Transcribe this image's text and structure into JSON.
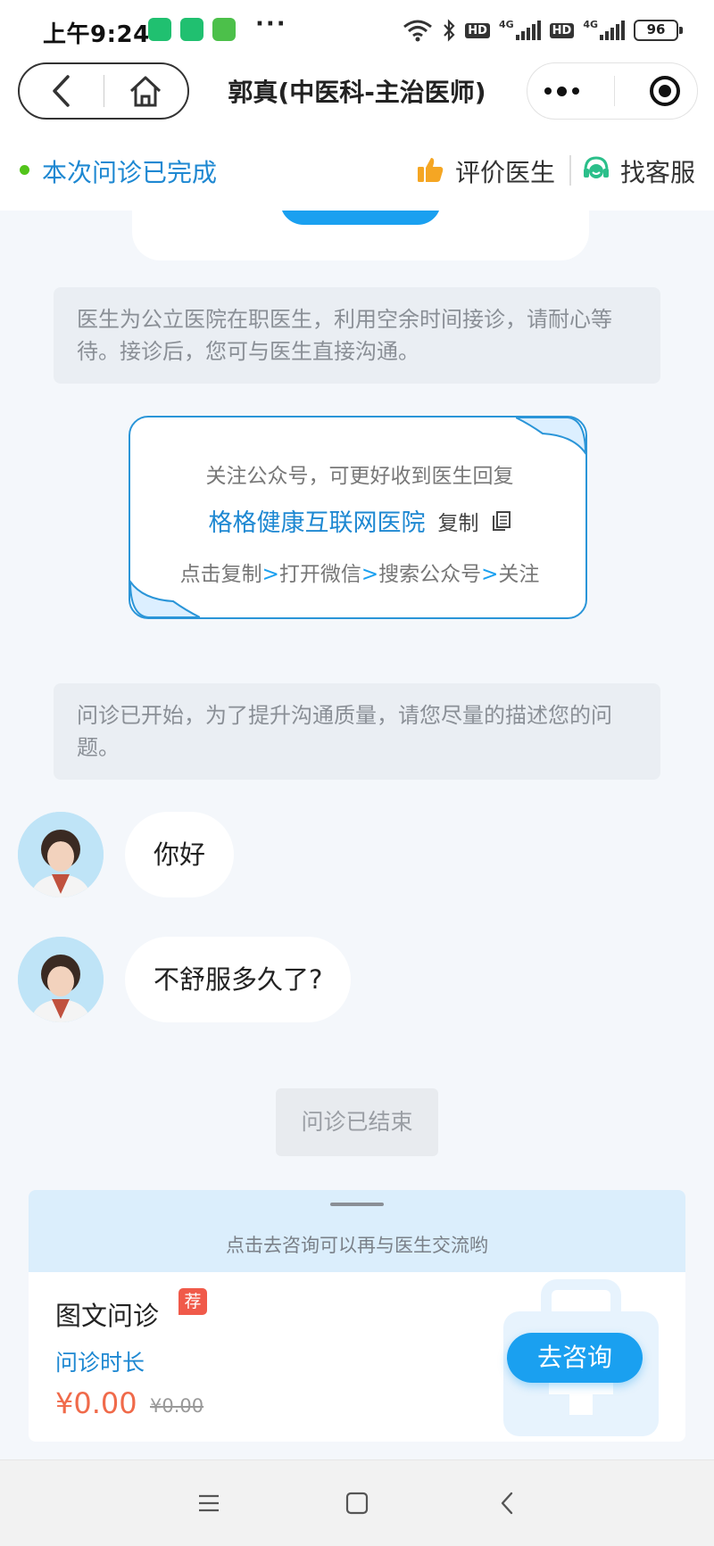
{
  "status_bar": {
    "time": "上午9:24",
    "more": "···",
    "network": "4G",
    "hd": "HD",
    "battery": "96"
  },
  "nav": {
    "title": "郭真(中医科-主治医师)"
  },
  "consult_bar": {
    "status": "本次问诊已完成",
    "rate_doctor": "评价医生",
    "customer_service": "找客服"
  },
  "chat": {
    "notice_1": "医生为公立医院在职医生，利用空余时间接诊，请耐心等待。接诊后，您可与医生直接沟通。",
    "follow_card": {
      "line1": "关注公众号，可更好收到医生回复",
      "account_name": "格格健康互联网医院",
      "copy_label": "复制",
      "step_1": "点击复制",
      "step_2": "打开微信",
      "step_3": "搜索公众号",
      "step_4": "关注",
      "arrow": ">"
    },
    "notice_2": "问诊已开始，为了提升沟通质量，请您尽量的描述您的问题。",
    "messages": [
      {
        "sender": "doctor",
        "text": "你好"
      },
      {
        "sender": "doctor",
        "text": "不舒服多久了?"
      }
    ],
    "ended_label": "问诊已结束"
  },
  "bottom_sheet": {
    "hint": "点击去咨询可以再与医生交流哟",
    "service_title": "图文问诊",
    "badge": "荐",
    "duration_label": "问诊时长",
    "price": "¥0.00",
    "original_price": "¥0.00",
    "consult_button": "去咨询"
  },
  "colors": {
    "primary": "#1aa0f0",
    "link_blue": "#1e88d2",
    "price": "#f06a4a",
    "badge": "#f05a4a",
    "online_dot": "#52c41a"
  }
}
